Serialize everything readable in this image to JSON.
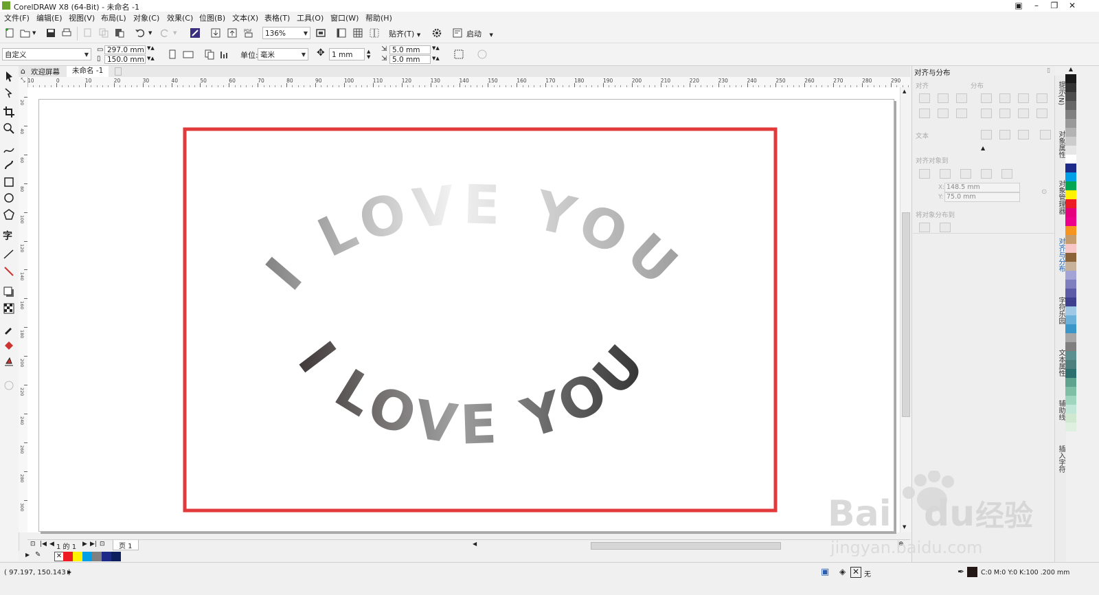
{
  "window": {
    "title": "CorelDRAW X8 (64-Bit) - 未命名 -1"
  },
  "menu": [
    "文件(F)",
    "编辑(E)",
    "视图(V)",
    "布局(L)",
    "对象(C)",
    "效果(C)",
    "位图(B)",
    "文本(X)",
    "表格(T)",
    "工具(O)",
    "窗口(W)",
    "帮助(H)"
  ],
  "toolbar": {
    "zoom": "136%",
    "snap_label": "贴齐(T)",
    "launch_label": "启动"
  },
  "property_bar": {
    "page_preset": "自定义",
    "width": "297.0 mm",
    "height": "150.0 mm",
    "units_label": "单位:",
    "units": "毫米",
    "nudge": "1 mm",
    "dup_x": "5.0 mm",
    "dup_y": "5.0 mm"
  },
  "doc_tabs": [
    {
      "label": "欢迎屏幕",
      "active": false
    },
    {
      "label": "未命名 -1",
      "active": true
    }
  ],
  "ruler": {
    "h_ticks": [
      "10",
      "0",
      "10",
      "20",
      "30",
      "40",
      "50",
      "60",
      "70",
      "80",
      "90",
      "100",
      "110",
      "120",
      "130",
      "140",
      "150",
      "160",
      "170",
      "180",
      "190",
      "200",
      "210",
      "220",
      "230",
      "240",
      "250",
      "260",
      "270",
      "280",
      "290"
    ],
    "v_ticks": [
      "20",
      "40",
      "60",
      "80",
      "100",
      "120",
      "140",
      "160",
      "180",
      "200",
      "220",
      "240",
      "260",
      "280",
      "300"
    ]
  },
  "artwork": {
    "top_text": "I LOVE YOU",
    "bottom_text": "I LOVE YOU",
    "frame_color": "#e23a3a"
  },
  "page_nav": {
    "text": "1 的 1",
    "page_tab": "页 1"
  },
  "status": {
    "coords": "( 97.197, 150.143 )",
    "fill_label": "无",
    "outline_info": "C:0 M:0 Y:0 K:100 .200 mm"
  },
  "docker": {
    "title": "对齐与分布",
    "align_label": "对齐",
    "distribute_label": "分布",
    "text_label": "文本",
    "align_to_label": "对齐对象到",
    "x_value": "148.5 mm",
    "y_value": "75.0 mm",
    "distribute_to_label": "将对象分布到",
    "x_prefix": "X:",
    "y_prefix": "Y:"
  },
  "docker_tabs": [
    "提示(N)",
    "对象属性",
    "对象管理器",
    "对齐与分布",
    "字符乐园",
    "文本属性",
    "辅助线",
    "插入字符"
  ],
  "colors": {
    "palette": [
      "#1a1a1a",
      "#333333",
      "#4d4d4d",
      "#666666",
      "#808080",
      "#999999",
      "#b3b3b3",
      "#cccccc",
      "#e6e6e6",
      "#ffffff",
      "#1d2a8a",
      "#00a0e9",
      "#00a651",
      "#fff200",
      "#ed1c24",
      "#e6007e",
      "#ec008c",
      "#f7941d",
      "#c69c6d",
      "#f8c6c6",
      "#8c6239",
      "#c7b299",
      "#a3a3d6",
      "#7f7fbf",
      "#5b5ba8",
      "#3f3f8f",
      "#9ec8e6",
      "#6ab0d8",
      "#3a95c9",
      "#a6a6a6",
      "#7f7f7f",
      "#5c8f8f",
      "#4d7f7f",
      "#2d6f6f",
      "#5fa38f",
      "#7fbfa6",
      "#9fd4bf",
      "#bfe6d6",
      "#cfe8cf",
      "#e0f0e0"
    ],
    "mini_palette": [
      "#ed1c24",
      "#fff200",
      "#00a0e9",
      "#808080",
      "#1d2a8a",
      "#0d1f5c"
    ]
  },
  "watermark": {
    "line1": "Baidu经验",
    "line2": "jingyan.baidu.com"
  }
}
